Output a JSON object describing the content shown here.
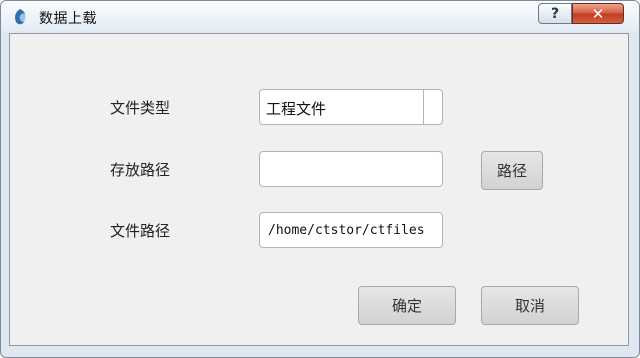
{
  "window": {
    "title": "数据上载",
    "help_label": "?",
    "close_label": "✕"
  },
  "form": {
    "file_type": {
      "label": "文件类型",
      "value": "工程文件"
    },
    "save_path": {
      "label": "存放路径",
      "value": "",
      "browse_label": "路径"
    },
    "file_path": {
      "label": "文件路径",
      "value": "/home/ctstor/ctfiles"
    }
  },
  "actions": {
    "confirm_label": "确定",
    "cancel_label": "取消"
  },
  "icons": {
    "app": "app-icon",
    "help": "help-icon",
    "close": "close-icon"
  }
}
